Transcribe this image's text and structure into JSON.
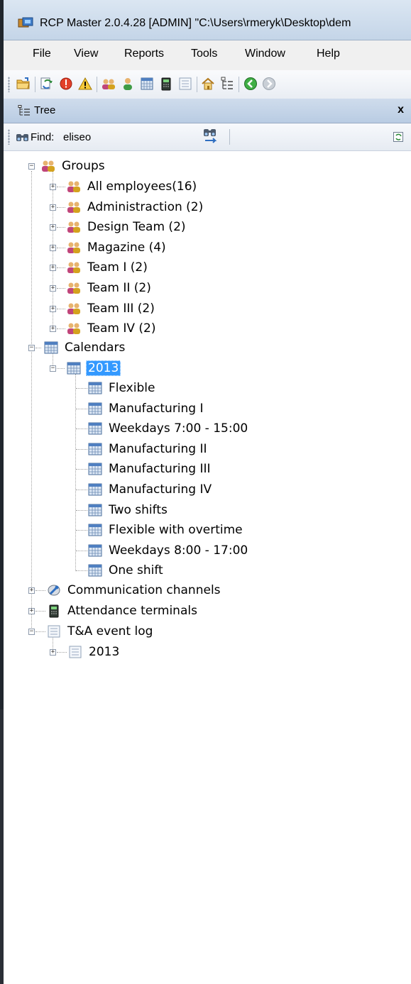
{
  "window": {
    "title": "RCP Master 2.0.4.28  [ADMIN] \"C:\\Users\\rmeryk\\Desktop\\dem"
  },
  "menu": [
    "File",
    "View",
    "Reports",
    "Tools",
    "Window",
    "Help"
  ],
  "toolbar": {
    "icons": [
      "open-folder-icon",
      "refresh-icon",
      "error-icon",
      "warning-icon",
      "group-icon",
      "user-icon",
      "calendar-icon",
      "terminal-icon",
      "list-icon",
      "home-icon",
      "tree-icon",
      "back-icon",
      "forward-icon"
    ]
  },
  "panel": {
    "title": "Tree",
    "close": "x"
  },
  "find": {
    "label": "Find:",
    "value": "eliseo"
  },
  "tree": {
    "groups": {
      "label": "Groups",
      "items": [
        "All employees(16)",
        "Administraction (2)",
        "Design Team (2)",
        "Magazine (4)",
        "Team I (2)",
        "Team II (2)",
        "Team III (2)",
        "Team IV (2)"
      ]
    },
    "calendars": {
      "label": "Calendars",
      "year": "2013",
      "items": [
        "Flexible",
        "Manufacturing I",
        "Weekdays 7:00 - 15:00",
        "Manufacturing II",
        "Manufacturing III",
        "Manufacturing IV",
        "Two shifts",
        "Flexible with overtime",
        "Weekdays 8:00 - 17:00",
        "One shift"
      ]
    },
    "communication": "Communication channels",
    "terminals": "Attendance terminals",
    "eventlog": {
      "label": "T&A event log",
      "year": "2013"
    }
  }
}
